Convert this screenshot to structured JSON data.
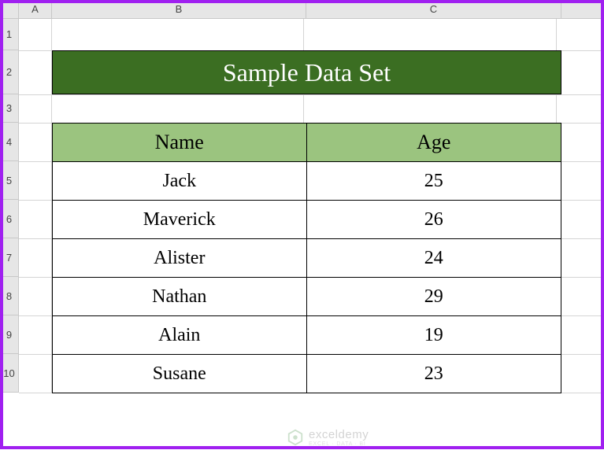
{
  "columns": [
    "A",
    "B",
    "C"
  ],
  "rows": [
    "1",
    "2",
    "3",
    "4",
    "5",
    "6",
    "7",
    "8",
    "9",
    "10"
  ],
  "title": "Sample Data Set",
  "table": {
    "headers": {
      "name": "Name",
      "age": "Age"
    },
    "rows": [
      {
        "name": "Jack",
        "age": "25"
      },
      {
        "name": "Maverick",
        "age": "26"
      },
      {
        "name": "Alister",
        "age": "24"
      },
      {
        "name": "Nathan",
        "age": "29"
      },
      {
        "name": "Alain",
        "age": "19"
      },
      {
        "name": "Susane",
        "age": "23"
      }
    ]
  },
  "watermark": {
    "main": "exceldemy",
    "sub": "EXCEL · DATA · BI"
  }
}
